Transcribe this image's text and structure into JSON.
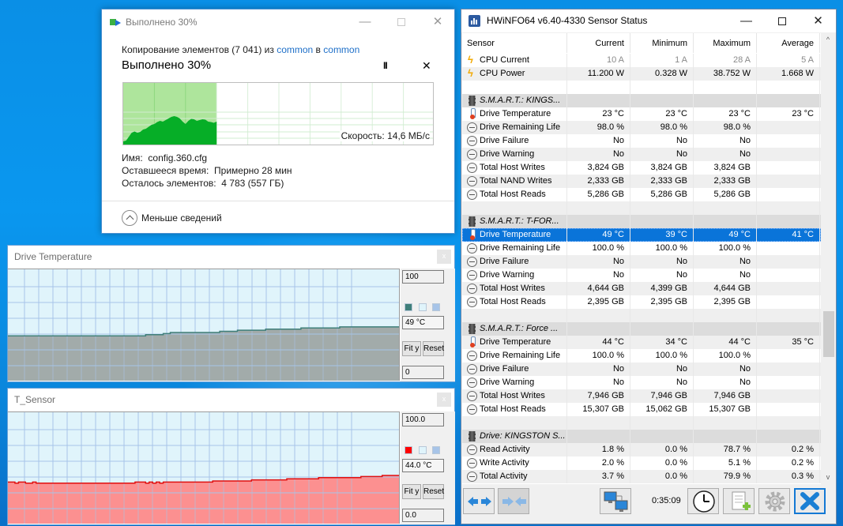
{
  "copy_dialog": {
    "title": "Выполнено 30%",
    "controls": {
      "minimize": "—",
      "close": "✕"
    },
    "copy_prefix": "Копирование элементов (7 041) из ",
    "source": "common",
    "middle": " в ",
    "destination": "common",
    "progress_title": "Выполнено 30%",
    "progress_percent": 30,
    "pause_icon": "pause-icon",
    "pause_glyph": "II",
    "cancel_glyph": "✕",
    "speed_label": "Скорость: 14,6 МБ/с",
    "speed_samples": [
      0.08,
      0.1,
      0.2,
      0.3,
      0.33,
      0.3,
      0.32,
      0.38,
      0.4,
      0.45,
      0.5,
      0.52,
      0.57,
      0.6,
      0.58,
      0.62,
      0.66,
      0.7,
      0.72,
      0.7,
      0.66,
      0.58,
      0.52,
      0.6,
      0.65,
      0.64,
      0.6,
      0.62,
      0.64,
      0.63,
      0.58,
      0.57,
      0.55,
      0.58
    ],
    "name_label": "Имя:",
    "name_value": "config.360.cfg",
    "time_label": "Оставшееся время:",
    "time_value": "Примерно 28 мин",
    "items_label": "Осталось элементов:",
    "items_value": "4 783 (557 ГБ)",
    "less_details": "Меньше сведений"
  },
  "graphs": [
    {
      "title": "Drive Temperature",
      "close_glyph": "x",
      "max_label": "100",
      "current_label": "49 °C",
      "min_label": "0",
      "fit_label": "Fit y",
      "reset_label": "Reset",
      "line_color": "#3f7f7a",
      "fill_color": "#a2abaa",
      "y_range": [
        0,
        100
      ],
      "values": [
        41,
        41,
        41,
        41,
        41,
        41,
        41,
        41,
        41,
        41,
        41,
        41,
        41,
        41,
        41,
        41,
        41,
        41,
        41,
        41,
        41,
        41,
        41,
        41,
        41,
        41,
        41,
        41,
        41,
        41,
        41,
        41,
        41,
        41,
        41,
        41,
        41,
        41,
        41,
        42,
        42,
        42,
        42,
        42,
        43,
        43,
        44,
        44,
        44,
        44,
        44,
        44,
        44,
        44,
        44,
        44,
        44,
        44,
        44,
        44,
        45,
        45,
        45,
        45,
        45,
        46,
        46,
        46,
        46,
        46,
        46,
        46,
        46,
        47,
        47,
        47,
        47,
        47,
        47,
        47,
        47,
        47,
        47,
        48,
        48,
        48,
        48,
        48,
        48,
        48,
        48,
        48,
        48,
        48,
        49,
        49,
        49,
        49,
        49,
        49,
        49,
        49,
        49,
        49,
        49,
        49,
        49,
        49,
        49,
        49,
        49
      ]
    },
    {
      "title": "T_Sensor",
      "close_glyph": "x",
      "max_label": "100.0",
      "current_label": "44.0 °C",
      "min_label": "0.0",
      "fit_label": "Fit y",
      "reset_label": "Reset",
      "line_color": "#e01010",
      "fill_color": "#fc9090",
      "y_range": [
        0,
        100
      ],
      "values": [
        38,
        38,
        37,
        38,
        38,
        37,
        37,
        38,
        37,
        37,
        37,
        37,
        37,
        37,
        37,
        37,
        37,
        37,
        37,
        37,
        37,
        37,
        37,
        37,
        37,
        37,
        37,
        37,
        37,
        37,
        37,
        37,
        37,
        37,
        37,
        37,
        38,
        38,
        38,
        37,
        38,
        37,
        38,
        37,
        38,
        38,
        38,
        38,
        38,
        38,
        38,
        38,
        38,
        38,
        38,
        38,
        38,
        38,
        39,
        39,
        39,
        39,
        39,
        39,
        39,
        39,
        39,
        39,
        39,
        40,
        40,
        40,
        40,
        40,
        40,
        40,
        40,
        40,
        40,
        41,
        41,
        41,
        41,
        41,
        41,
        41,
        41,
        41,
        42,
        42,
        42,
        42,
        42,
        42,
        42,
        42,
        42,
        42,
        42,
        42,
        43,
        43,
        43,
        43,
        43,
        43,
        44,
        44,
        44,
        44,
        44
      ]
    }
  ],
  "swatches": [
    [
      "#3f7f7a",
      "#e0f4fb",
      "#a7c4e8"
    ],
    [
      "#ff0000",
      "#e0f4fb",
      "#a7c4e8"
    ]
  ],
  "hwinfo": {
    "title": "HWiNFO64 v6.40-4330 Sensor Status",
    "controls": {
      "minimize": "—",
      "close": "✕"
    },
    "columns": [
      "Sensor",
      "Current",
      "Minimum",
      "Maximum",
      "Average"
    ],
    "rows": [
      {
        "type": "sensor",
        "icon": "bolt",
        "dim": true,
        "label": "CPU Current",
        "values": [
          "10 A",
          "1 A",
          "28 A",
          "5 A"
        ]
      },
      {
        "type": "sensor",
        "icon": "bolt",
        "label": "CPU Power",
        "values": [
          "11.200 W",
          "0.328 W",
          "38.752 W",
          "1.668 W"
        ]
      },
      {
        "type": "blank"
      },
      {
        "type": "group",
        "icon": "chip",
        "label": "S.M.A.R.T.: KINGS..."
      },
      {
        "type": "sensor",
        "icon": "therm",
        "label": "Drive Temperature",
        "values": [
          "23 °C",
          "23 °C",
          "23 °C",
          "23 °C"
        ]
      },
      {
        "type": "sensor",
        "icon": "clock",
        "label": "Drive Remaining Life",
        "values": [
          "98.0 %",
          "98.0 %",
          "98.0 %",
          ""
        ]
      },
      {
        "type": "sensor",
        "icon": "clock",
        "label": "Drive Failure",
        "values": [
          "No",
          "No",
          "No",
          ""
        ]
      },
      {
        "type": "sensor",
        "icon": "clock",
        "label": "Drive Warning",
        "values": [
          "No",
          "No",
          "No",
          ""
        ]
      },
      {
        "type": "sensor",
        "icon": "clock",
        "label": "Total Host Writes",
        "values": [
          "3,824 GB",
          "3,824 GB",
          "3,824 GB",
          ""
        ]
      },
      {
        "type": "sensor",
        "icon": "clock",
        "label": "Total NAND Writes",
        "values": [
          "2,333 GB",
          "2,333 GB",
          "2,333 GB",
          ""
        ]
      },
      {
        "type": "sensor",
        "icon": "clock",
        "label": "Total Host Reads",
        "values": [
          "5,286 GB",
          "5,286 GB",
          "5,286 GB",
          ""
        ]
      },
      {
        "type": "blank"
      },
      {
        "type": "group",
        "icon": "chip",
        "label": "S.M.A.R.T.: T-FOR..."
      },
      {
        "type": "sensor",
        "icon": "therm",
        "selected": true,
        "label": "Drive Temperature",
        "values": [
          "49 °C",
          "39 °C",
          "49 °C",
          "41 °C"
        ]
      },
      {
        "type": "sensor",
        "icon": "clock",
        "label": "Drive Remaining Life",
        "values": [
          "100.0 %",
          "100.0 %",
          "100.0 %",
          ""
        ]
      },
      {
        "type": "sensor",
        "icon": "clock",
        "label": "Drive Failure",
        "values": [
          "No",
          "No",
          "No",
          ""
        ]
      },
      {
        "type": "sensor",
        "icon": "clock",
        "label": "Drive Warning",
        "values": [
          "No",
          "No",
          "No",
          ""
        ]
      },
      {
        "type": "sensor",
        "icon": "clock",
        "label": "Total Host Writes",
        "values": [
          "4,644 GB",
          "4,399 GB",
          "4,644 GB",
          ""
        ]
      },
      {
        "type": "sensor",
        "icon": "clock",
        "label": "Total Host Reads",
        "values": [
          "2,395 GB",
          "2,395 GB",
          "2,395 GB",
          ""
        ]
      },
      {
        "type": "blank"
      },
      {
        "type": "group",
        "icon": "chip",
        "label": "S.M.A.R.T.: Force ..."
      },
      {
        "type": "sensor",
        "icon": "therm",
        "label": "Drive Temperature",
        "values": [
          "44 °C",
          "34 °C",
          "44 °C",
          "35 °C"
        ]
      },
      {
        "type": "sensor",
        "icon": "clock",
        "label": "Drive Remaining Life",
        "values": [
          "100.0 %",
          "100.0 %",
          "100.0 %",
          ""
        ]
      },
      {
        "type": "sensor",
        "icon": "clock",
        "label": "Drive Failure",
        "values": [
          "No",
          "No",
          "No",
          ""
        ]
      },
      {
        "type": "sensor",
        "icon": "clock",
        "label": "Drive Warning",
        "values": [
          "No",
          "No",
          "No",
          ""
        ]
      },
      {
        "type": "sensor",
        "icon": "clock",
        "label": "Total Host Writes",
        "values": [
          "7,946 GB",
          "7,946 GB",
          "7,946 GB",
          ""
        ]
      },
      {
        "type": "sensor",
        "icon": "clock",
        "label": "Total Host Reads",
        "values": [
          "15,307 GB",
          "15,062 GB",
          "15,307 GB",
          ""
        ]
      },
      {
        "type": "blank"
      },
      {
        "type": "group",
        "icon": "chip",
        "label": "Drive: KINGSTON S..."
      },
      {
        "type": "sensor",
        "icon": "clock",
        "label": "Read Activity",
        "values": [
          "1.8 %",
          "0.0 %",
          "78.7 %",
          "0.2 %"
        ]
      },
      {
        "type": "sensor",
        "icon": "clock",
        "label": "Write Activity",
        "values": [
          "2.0 %",
          "0.0 %",
          "5.1 %",
          "0.2 %"
        ]
      },
      {
        "type": "sensor",
        "icon": "clock",
        "label": "Total Activity",
        "values": [
          "3.7 %",
          "0.0 %",
          "79.9 %",
          "0.3 %"
        ]
      }
    ],
    "scroll_up": "^",
    "scroll_down": "v",
    "elapsed_time": "0:35:09",
    "toolbar": [
      {
        "name": "expand-columns-button",
        "icon": "arrows-out-icon"
      },
      {
        "name": "collapse-columns-button",
        "icon": "arrows-in-icon"
      },
      {
        "name": "network-button",
        "icon": "network-computers-icon"
      },
      {
        "name": "clock-reset-button",
        "icon": "clock-icon"
      },
      {
        "name": "logging-button",
        "icon": "add-log-icon"
      },
      {
        "name": "settings-button",
        "icon": "gear-icon"
      },
      {
        "name": "close-button",
        "icon": "close-x-icon"
      }
    ]
  }
}
